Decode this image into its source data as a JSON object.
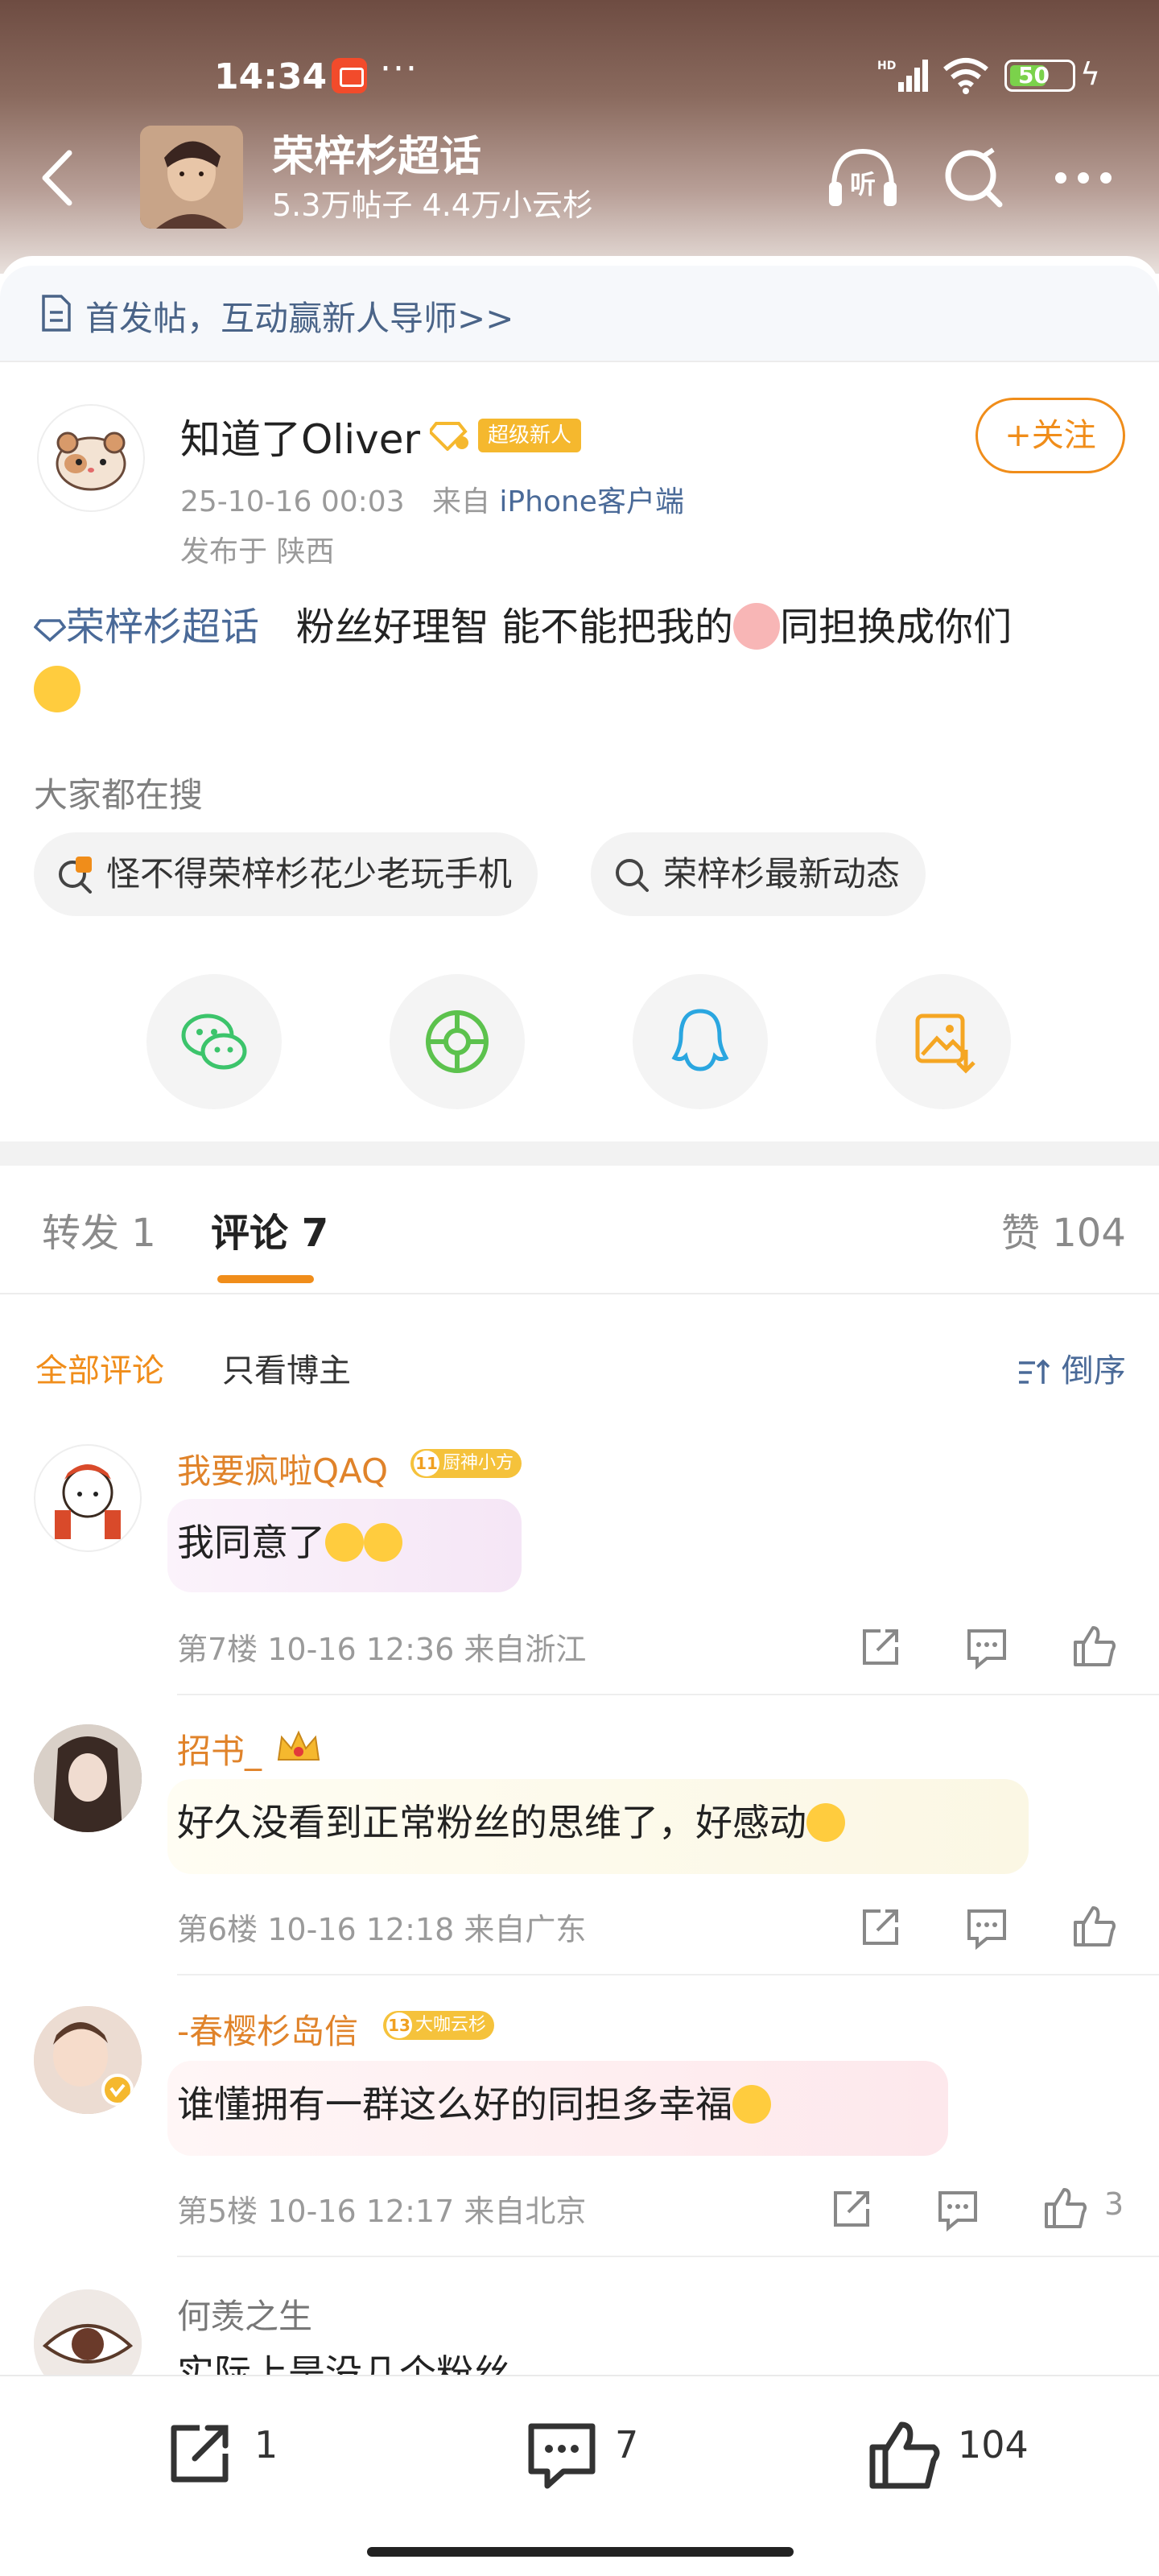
{
  "status_bar": {
    "time": "14:34",
    "more": "···",
    "network": "HD",
    "battery": "50"
  },
  "header": {
    "title": "荣梓杉超话",
    "subtitle": "5.3万帖子 4.4万小云杉",
    "listen_icon": "listen-icon",
    "search_icon": "search-icon",
    "more_icon": "more-icon"
  },
  "banner": {
    "text": "首发帖，互动赢新人导师>>"
  },
  "post": {
    "author": "知道了Oliver",
    "badge": "超级新人",
    "time": "25-10-16 00:03",
    "source_prefix": "来自",
    "source": "iPhone客户端",
    "location": "发布于 陕西",
    "follow_label": "+关注",
    "tag": "荣梓杉超话",
    "body_part1": "粉丝好理智 能不能把我的",
    "body_part2": "同担换成你们"
  },
  "search": {
    "title": "大家都在搜",
    "chips": [
      "怪不得荣梓杉花少老玩手机",
      "荣梓杉最新动态"
    ]
  },
  "share": {
    "items": [
      "wechat-icon",
      "moments-icon",
      "qq-icon",
      "save-image-icon"
    ]
  },
  "tabs": {
    "repost": "转发 1",
    "comments": "评论 7",
    "likes": "赞 104"
  },
  "filters": {
    "all": "全部评论",
    "op_only": "只看博主",
    "sort": "倒序"
  },
  "comments": [
    {
      "name": "我要疯啦QAQ",
      "badge_level": "11",
      "badge": "厨神小方",
      "text": "我同意了",
      "meta": "第7楼 10-16 12:36 来自浙江",
      "likes": ""
    },
    {
      "name": "招书_",
      "badge_level": "",
      "badge": "",
      "text": "好久没看到正常粉丝的思维了，好感动",
      "meta": "第6楼 10-16 12:18 来自广东",
      "likes": ""
    },
    {
      "name": "-春樱杉岛信",
      "badge_level": "13",
      "badge": "大咖云杉",
      "text": "谁懂拥有一群这么好的同担多幸福",
      "meta": "第5楼 10-16 12:17 来自北京",
      "likes": "3"
    },
    {
      "name": "何羡之生",
      "badge_level": "",
      "badge": "",
      "text": "实际上是没几个粉丝",
      "meta": "",
      "likes": ""
    }
  ],
  "bottom_bar": {
    "repost_count": "1",
    "comment_count": "7",
    "like_count": "104"
  },
  "colors": {
    "accent": "#f08d1a",
    "link": "#4a6a98",
    "username": "#e0832a"
  }
}
